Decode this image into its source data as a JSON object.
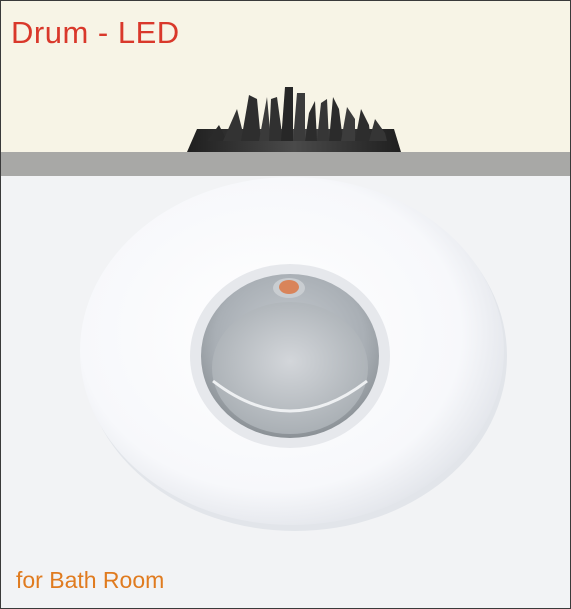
{
  "product": {
    "title": "Drum - LED",
    "subtitle": "for Bath Room"
  },
  "colors": {
    "title": "#d9382b",
    "subtitle": "#e07b1f",
    "top_band": "#f7f4e6",
    "ceiling_bar": "#a8a8a6",
    "heatsink": "#2f2f2f",
    "trim_ring": "#ffffff",
    "lens": "#b8bdc2",
    "led_chip": "#d9845a"
  },
  "icons": {
    "heatsink": "heatsink-fins-image",
    "downlight": "round-downlight-image"
  }
}
